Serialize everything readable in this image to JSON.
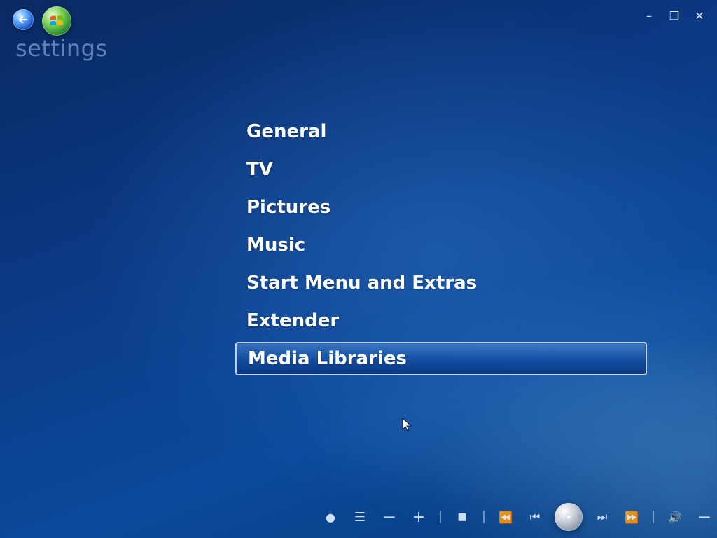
{
  "app": {
    "title": "settings"
  },
  "top_left": {
    "back_icon": "back-arrow-icon",
    "start_icon": "windows-start-orb-icon"
  },
  "window_controls": {
    "minimize": "–",
    "restore": "❐",
    "close": "✕"
  },
  "menu": {
    "items": [
      {
        "label": "General",
        "selected": false
      },
      {
        "label": "TV",
        "selected": false
      },
      {
        "label": "Pictures",
        "selected": false
      },
      {
        "label": "Music",
        "selected": false
      },
      {
        "label": "Start Menu and Extras",
        "selected": false
      },
      {
        "label": "Extender",
        "selected": false
      },
      {
        "label": "Media Libraries",
        "selected": true
      }
    ]
  },
  "transport": {
    "record": "●",
    "guide": "☰",
    "channel_down": "−",
    "channel_up": "+",
    "stop": "■",
    "rewind": "⏪",
    "previous": "⏮",
    "next": "⏭",
    "fast_forward": "⏩",
    "volume": "🔊",
    "volume_down": "−",
    "volume_up": "+"
  },
  "colors": {
    "accent": "#0b4a9b",
    "selected_border": "#d7ebff",
    "text": "#ffffff"
  }
}
